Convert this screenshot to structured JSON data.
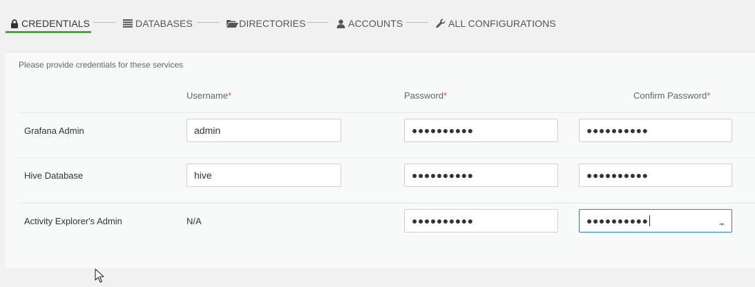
{
  "nav": {
    "steps": [
      {
        "label": "CREDENTIALS",
        "icon": "lock-icon",
        "active": true
      },
      {
        "label": "DATABASES",
        "icon": "list-icon",
        "active": false
      },
      {
        "label": "DIRECTORIES",
        "icon": "folder-open-icon",
        "active": false
      },
      {
        "label": "ACCOUNTS",
        "icon": "user-icon",
        "active": false
      },
      {
        "label": "ALL CONFIGURATIONS",
        "icon": "wrench-icon",
        "active": false
      }
    ],
    "accent_color": "#3fae2a"
  },
  "panel": {
    "hint": "Please provide credentials for these services",
    "columns": {
      "username": "Username",
      "password": "Password",
      "confirm_password": "Confirm Password",
      "required_mark": "*"
    },
    "rows": [
      {
        "label": "Grafana Admin",
        "username": "admin",
        "password": "●●●●●●●●●●",
        "confirm": "●●●●●●●●●●"
      },
      {
        "label": "Hive Database",
        "username": "hive",
        "password": "●●●●●●●●●●",
        "confirm": "●●●●●●●●●●"
      },
      {
        "label": "Activity Explorer's Admin",
        "username": "N/A",
        "password": "●●●●●●●●●●",
        "confirm": "●●●●●●●●●●"
      }
    ]
  }
}
